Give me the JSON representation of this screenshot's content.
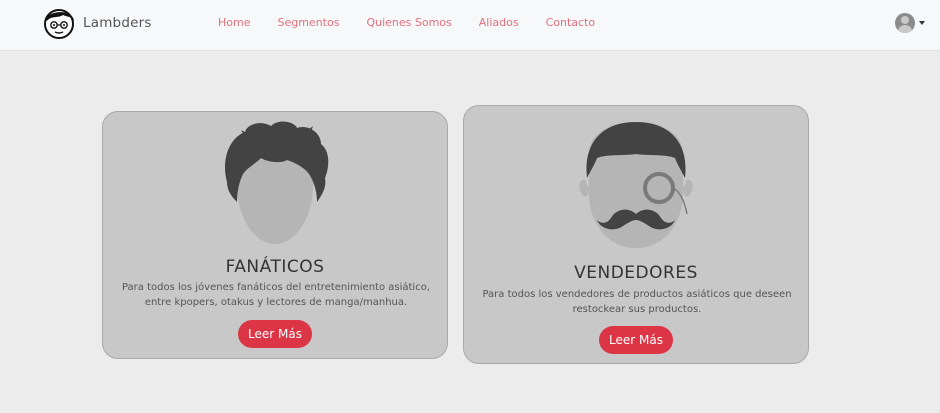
{
  "brand": {
    "name": "Lambders",
    "logo_icon": "cartoon-boy-face-icon"
  },
  "nav": {
    "links": [
      "Home",
      "Segmentos",
      "Quienes Somos",
      "Aliados",
      "Contacto"
    ],
    "link_color": "#e0707c"
  },
  "user_menu": {
    "icon": "user-avatar-icon"
  },
  "cards": [
    {
      "icon": "young-man-messy-hair-icon",
      "title": "FANÁTICOS",
      "description": "Para todos los jóvenes fanáticos del entretenimiento asiático, entre kpopers, otakus y lectores de manga/manhua.",
      "button_label": "Leer Más"
    },
    {
      "icon": "gentleman-monocle-mustache-icon",
      "title": "VENDEDORES",
      "description": "Para todos los vendedores de productos asiáticos que deseen restockear sus productos.",
      "button_label": "Leer Más"
    }
  ],
  "colors": {
    "accent": "#dc3545",
    "card_bg": "#c8c8c8",
    "page_bg": "#ececec"
  }
}
